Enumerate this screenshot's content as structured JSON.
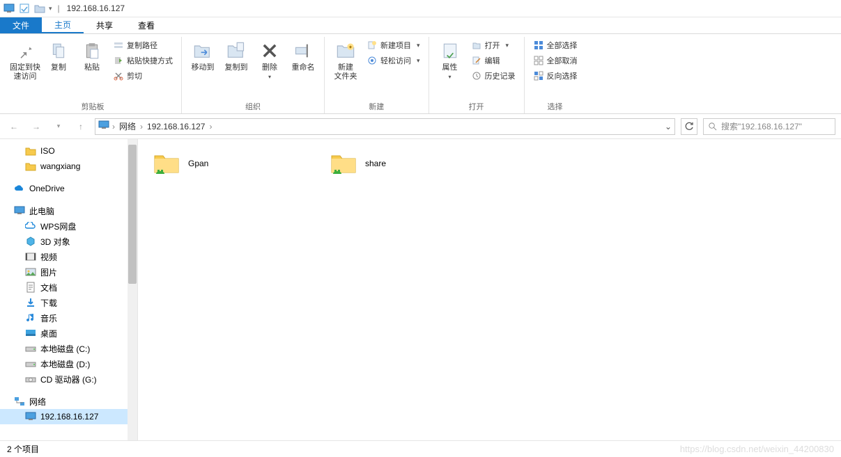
{
  "titlebar": {
    "title": "192.168.16.127",
    "separator": "|"
  },
  "tabs": {
    "file": "文件",
    "home": "主页",
    "share": "共享",
    "view": "查看"
  },
  "ribbon": {
    "clipboard": {
      "group_label": "剪贴板",
      "pin": "固定到快\n速访问",
      "copy": "复制",
      "paste": "粘贴",
      "copy_path": "复制路径",
      "paste_shortcut": "粘贴快捷方式",
      "cut": "剪切"
    },
    "organize": {
      "group_label": "组织",
      "move_to": "移动到",
      "copy_to": "复制到",
      "delete": "删除",
      "rename": "重命名"
    },
    "new": {
      "group_label": "新建",
      "new_folder": "新建\n文件夹",
      "new_item": "新建项目",
      "easy_access": "轻松访问"
    },
    "open": {
      "group_label": "打开",
      "properties": "属性",
      "open": "打开",
      "edit": "编辑",
      "history": "历史记录"
    },
    "select": {
      "group_label": "选择",
      "select_all": "全部选择",
      "select_none": "全部取消",
      "invert": "反向选择"
    }
  },
  "addressbar": {
    "network": "网络",
    "ip": "192.168.16.127",
    "search_placeholder": "搜索\"192.168.16.127\""
  },
  "sidebar": {
    "items": [
      {
        "label": "ISO",
        "icon": "folder",
        "indent": 1
      },
      {
        "label": "wangxiang",
        "icon": "folder",
        "indent": 1
      },
      {
        "spacer": true
      },
      {
        "label": "OneDrive",
        "icon": "onedrive",
        "indent": 0
      },
      {
        "spacer": true
      },
      {
        "label": "此电脑",
        "icon": "computer",
        "indent": 0
      },
      {
        "label": "WPS网盘",
        "icon": "wps",
        "indent": 1
      },
      {
        "label": "3D 对象",
        "icon": "3d",
        "indent": 1
      },
      {
        "label": "视频",
        "icon": "video",
        "indent": 1
      },
      {
        "label": "图片",
        "icon": "picture",
        "indent": 1
      },
      {
        "label": "文档",
        "icon": "document",
        "indent": 1
      },
      {
        "label": "下载",
        "icon": "download",
        "indent": 1
      },
      {
        "label": "音乐",
        "icon": "music",
        "indent": 1
      },
      {
        "label": "桌面",
        "icon": "desktop",
        "indent": 1
      },
      {
        "label": "本地磁盘 (C:)",
        "icon": "drive",
        "indent": 1
      },
      {
        "label": "本地磁盘 (D:)",
        "icon": "drive",
        "indent": 1
      },
      {
        "label": "CD 驱动器 (G:)",
        "icon": "cd",
        "indent": 1
      },
      {
        "spacer": true
      },
      {
        "label": "网络",
        "icon": "network",
        "indent": 0
      },
      {
        "label": "192.168.16.127",
        "icon": "computer",
        "indent": 1,
        "selected": true
      }
    ]
  },
  "content": {
    "folders": [
      {
        "name": "Gpan"
      },
      {
        "name": "share"
      }
    ]
  },
  "statusbar": {
    "items_count": "2 个项目"
  },
  "watermark": "https://blog.csdn.net/weixin_44200830"
}
